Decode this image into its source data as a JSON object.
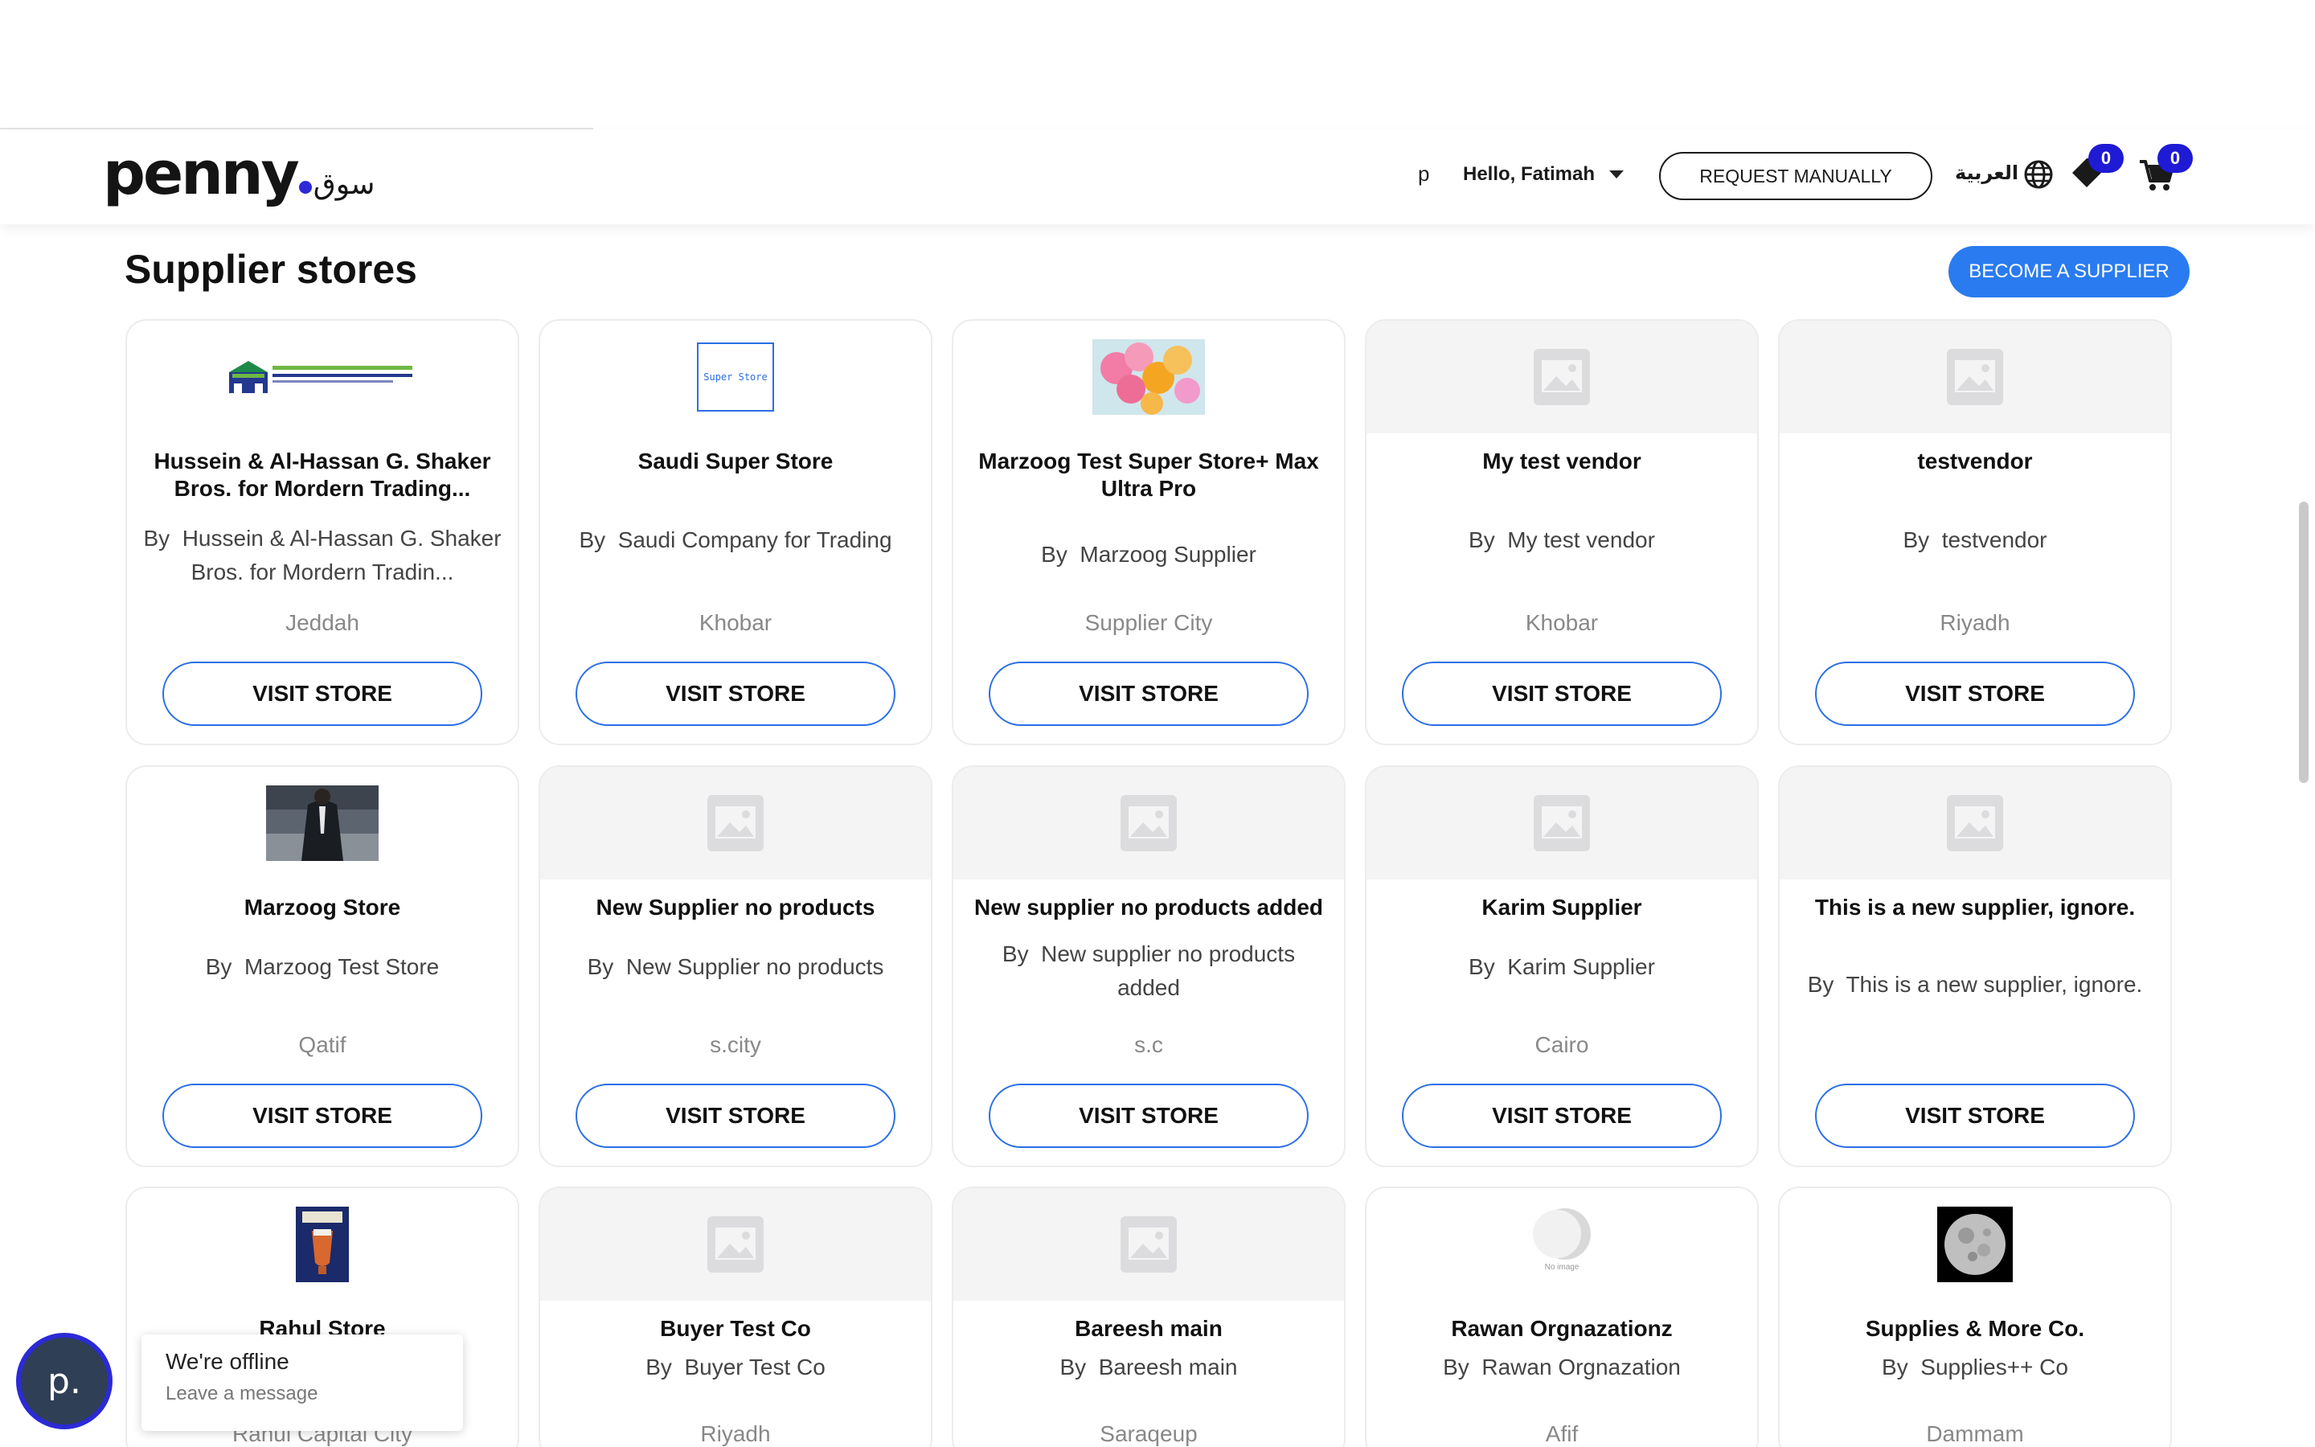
{
  "header": {
    "logo_text": "penny",
    "logo_arabic": "سوق",
    "user_initial": "p",
    "greeting": "Hello, Fatimah",
    "request_button": "REQUEST MANUALLY",
    "language": "العربية",
    "wishlist_count": "0",
    "cart_count": "0"
  },
  "page": {
    "title": "Supplier stores",
    "become_supplier": "BECOME A SUPPLIER",
    "visit_label": "VISIT STORE",
    "by_prefix": "By"
  },
  "stores": [
    {
      "name": "Hussein & Al-Hassan G. Shaker Bros. for Mordern Trading...",
      "by": "Hussein & Al-Hassan G. Shaker Bros. for Mordern Tradin...",
      "city": "Jeddah",
      "image": "shaker-logo"
    },
    {
      "name": "Saudi Super Store",
      "by": "Saudi Company for Trading",
      "city": "Khobar",
      "image": "super-store-logo",
      "image_text": "Super Store"
    },
    {
      "name": "Marzoog Test Super Store+ Max Ultra Pro",
      "by": "Marzoog Supplier",
      "city": "Supplier City",
      "image": "balloons-photo"
    },
    {
      "name": "My test vendor",
      "by": "My test vendor",
      "city": "Khobar",
      "image": "placeholder"
    },
    {
      "name": "testvendor",
      "by": "testvendor",
      "city": "Riyadh",
      "image": "placeholder"
    },
    {
      "name": "Marzoog Store",
      "by": "Marzoog Test Store",
      "city": "Qatif",
      "image": "suit-photo"
    },
    {
      "name": "New Supplier no products",
      "by": "New Supplier no products",
      "city": "s.city",
      "image": "placeholder"
    },
    {
      "name": "New supplier no products added",
      "by": "New supplier no products added",
      "city": "s.c",
      "image": "placeholder"
    },
    {
      "name": "Karim Supplier",
      "by": "Karim Supplier",
      "city": "Cairo",
      "image": "placeholder"
    },
    {
      "name": "This is a new supplier, ignore.",
      "by": "This is a new supplier, ignore.",
      "city": "",
      "image": "placeholder"
    },
    {
      "name": "Rahul Store",
      "by": "",
      "city": "Rahul Capital City",
      "image": "book-cover"
    },
    {
      "name": "Buyer Test Co",
      "by": "Buyer Test Co",
      "city": "Riyadh",
      "image": "placeholder"
    },
    {
      "name": "Bareesh main",
      "by": "Bareesh main",
      "city": "Saraqeup",
      "image": "placeholder"
    },
    {
      "name": "Rawan Orgnazationz",
      "by": "Rawan Orgnazation",
      "city": "Afif",
      "image": "no-image-logo",
      "image_text": "No image"
    },
    {
      "name": "Supplies & More Co.",
      "by": "Supplies++ Co",
      "city": "Dammam",
      "image": "moon-photo"
    }
  ],
  "chat": {
    "avatar_letter": "p.",
    "status": "We're offline",
    "cta": "Leave a message"
  },
  "colors": {
    "brand_dot": "#2f2ad8",
    "primary_blue": "#2a7bf0",
    "badge": "#1f1ad4",
    "button_outline": "#2a6fe6"
  }
}
